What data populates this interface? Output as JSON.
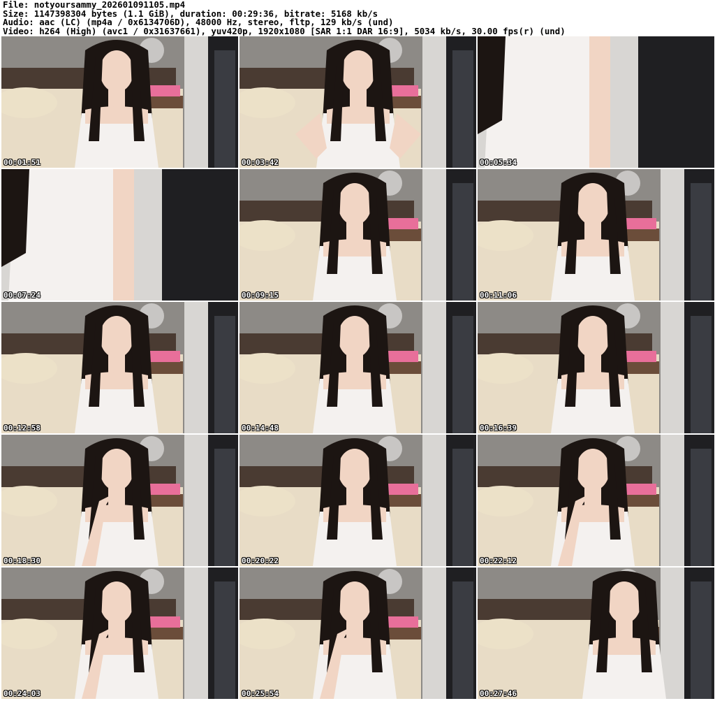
{
  "header": {
    "file_line": "File: notyoursammy_202601091105.mp4",
    "size_line": "Size: 1147398304 bytes (1.1 GiB), duration: 00:29:36, bitrate: 5168 kb/s",
    "audio_line": "Audio: aac (LC) (mp4a / 0x6134706D), 48000 Hz, stereo, fltp, 129 kb/s (und)",
    "video_line": "Video: h264 (High) (avc1 / 0x31637661), yuv420p, 1920x1080 [SAR 1:1 DAR 16:9], 5034 kb/s, 30.00 fps(r) (und)"
  },
  "thumbnails": [
    {
      "timestamp": "00:01:51",
      "variant": "seated"
    },
    {
      "timestamp": "00:03:42",
      "variant": "hands-on-hips"
    },
    {
      "timestamp": "00:05:34",
      "variant": "closeup-dress"
    },
    {
      "timestamp": "00:07:24",
      "variant": "closeup-side"
    },
    {
      "timestamp": "00:09:15",
      "variant": "seated"
    },
    {
      "timestamp": "00:11:06",
      "variant": "seated"
    },
    {
      "timestamp": "00:12:58",
      "variant": "seated"
    },
    {
      "timestamp": "00:14:48",
      "variant": "seated"
    },
    {
      "timestamp": "00:16:39",
      "variant": "seated"
    },
    {
      "timestamp": "00:18:30",
      "variant": "hand-in-hair"
    },
    {
      "timestamp": "00:20:22",
      "variant": "seated"
    },
    {
      "timestamp": "00:22:12",
      "variant": "chin-on-hand"
    },
    {
      "timestamp": "00:24:03",
      "variant": "chin-on-hand"
    },
    {
      "timestamp": "00:25:54",
      "variant": "chin-on-hand"
    },
    {
      "timestamp": "00:27:46",
      "variant": "seated-right"
    }
  ],
  "colors": {
    "wall": "#8d8a86",
    "headboard": "#4a3b32",
    "bed": "#e8dcc6",
    "pillow": "#ece1c8",
    "shelf": "#6b4d3a",
    "pink": "#e86f9a",
    "hair": "#1c1512",
    "skin": "#f1d5c4",
    "dress": "#f4f1ef",
    "door": "#1f1f22",
    "right_wall": "#d8d6d3"
  }
}
